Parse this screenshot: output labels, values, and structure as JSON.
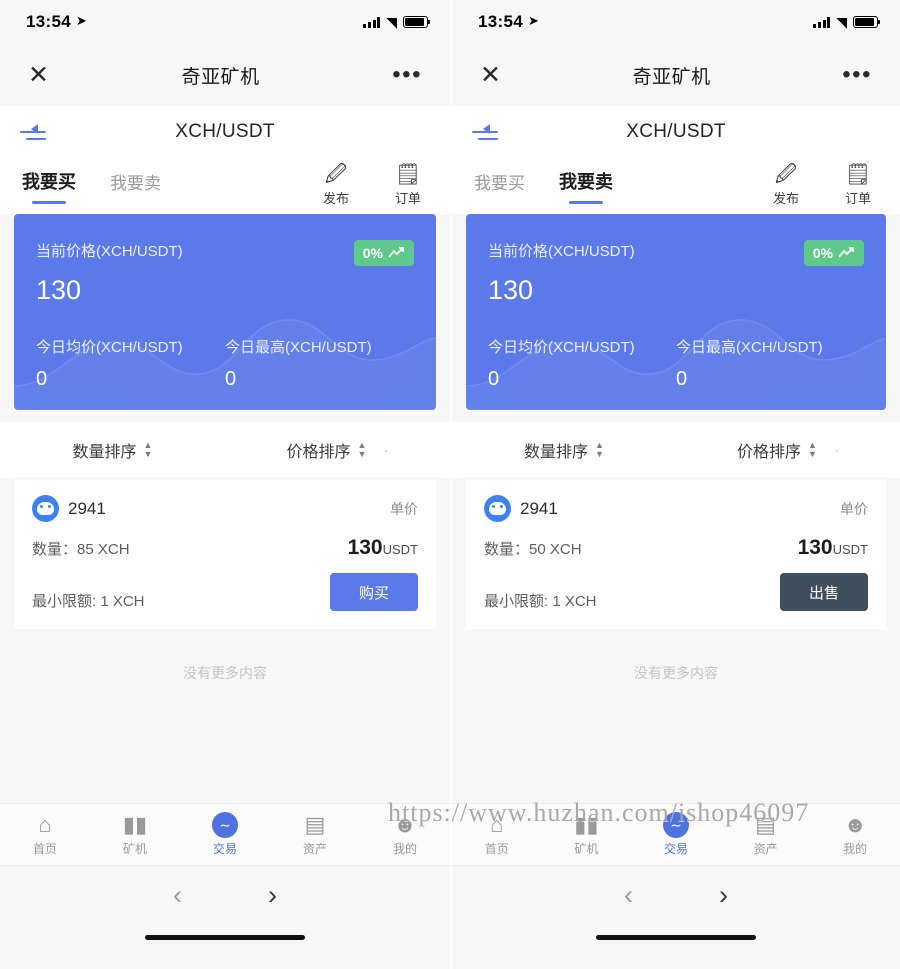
{
  "status_bar": {
    "time": "13:54",
    "location_icon": "location-arrow-icon",
    "signal_icon": "cellular-signal-icon",
    "wifi_icon": "wifi-icon",
    "battery_icon": "battery-icon"
  },
  "wechat_nav": {
    "close_icon": "close-icon",
    "title": "奇亚矿机",
    "more_icon": "ellipsis-icon"
  },
  "app_header": {
    "menu_icon": "list-menu-icon",
    "pair": "XCH/USDT"
  },
  "tools": [
    {
      "icon": "publish-pencil-icon",
      "glyph": "🖉",
      "label": "发布"
    },
    {
      "icon": "order-clipboard-icon",
      "glyph": "🗒",
      "label": "订单"
    }
  ],
  "sorters": [
    {
      "label": "数量排序",
      "icon": "sort-updown-icon"
    },
    {
      "label": "价格排序",
      "icon": "sort-updown-icon",
      "trailing": "·"
    }
  ],
  "price_card": {
    "current_label": "当前价格(XCH/USDT)",
    "current_value": "130",
    "change_pct": "0%",
    "change_icon": "trend-up-icon",
    "avg_label": "今日均价(XCH/USDT)",
    "avg_value": "0",
    "high_label": "今日最高(XCH/USDT)",
    "high_value": "0",
    "accent": "#5b79e8",
    "badge_color": "#5ec98b"
  },
  "no_more": "没有更多内容",
  "bottom_tabs": [
    {
      "label": "首页",
      "icon": "home-icon",
      "glyph": "⌂",
      "active": false
    },
    {
      "label": "矿机",
      "icon": "server-rack-icon",
      "glyph": "▮▮",
      "active": false
    },
    {
      "label": "交易",
      "icon": "exchange-icon",
      "glyph": "∼",
      "active": true
    },
    {
      "label": "资产",
      "icon": "wallet-icon",
      "glyph": "▤",
      "active": false
    },
    {
      "label": "我的",
      "icon": "person-icon",
      "glyph": "☻",
      "active": false
    }
  ],
  "browser_bar": {
    "back_icon": "chevron-left-icon",
    "forward_icon": "chevron-right-icon"
  },
  "watermark": "https://www.huzhan.com/ishop46097",
  "panels": [
    {
      "id": "buy-panel",
      "tabs": [
        {
          "label": "我要买",
          "active": true
        },
        {
          "label": "我要卖",
          "active": false
        }
      ],
      "offer": {
        "avatar_icon": "user-avatar-icon",
        "name": "2941",
        "unit_label": "单价",
        "amount_label": "数量：85 XCH",
        "price": "130",
        "price_unit": "USDT",
        "min_label": "最小限额: 1 XCH",
        "action_label": "购买",
        "action_style": "primary"
      }
    },
    {
      "id": "sell-panel",
      "tabs": [
        {
          "label": "我要买",
          "active": false
        },
        {
          "label": "我要卖",
          "active": true
        }
      ],
      "offer": {
        "avatar_icon": "user-avatar-icon",
        "name": "2941",
        "unit_label": "单价",
        "amount_label": "数量：50 XCH",
        "price": "130",
        "price_unit": "USDT",
        "min_label": "最小限额: 1 XCH",
        "action_label": "出售",
        "action_style": "dark"
      }
    }
  ]
}
